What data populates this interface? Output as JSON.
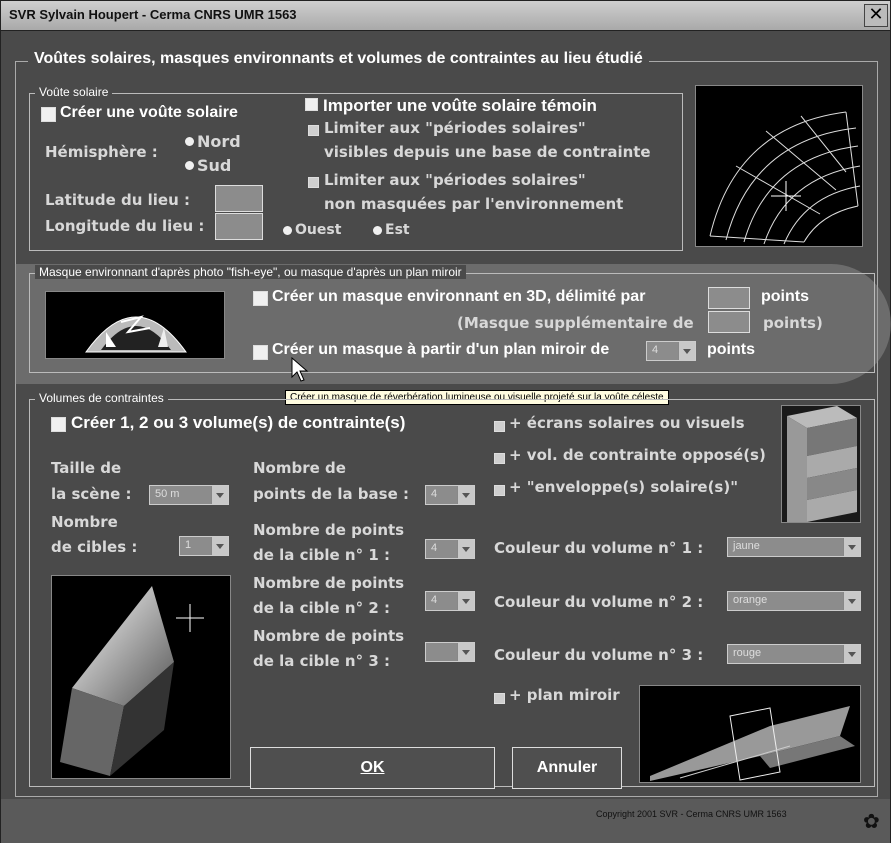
{
  "window": {
    "title": "SVR Sylvain Houpert - Cerma CNRS UMR 1563",
    "close": "✕"
  },
  "main_legend": "Voûtes solaires, masques environnants et volumes de contraintes au lieu étudié",
  "voute": {
    "legend": "Voûte solaire",
    "creer": "Créer une voûte solaire",
    "hemisphere_label": "Hémisphère :",
    "nord": "Nord",
    "sud": "Sud",
    "latitude": "Latitude du lieu :",
    "longitude": "Longitude du lieu :",
    "ouest": "Ouest",
    "est": "Est",
    "importer": "Importer une voûte solaire témoin",
    "limiter1_l1": "Limiter aux \"périodes solaires\"",
    "limiter1_l2": "visibles depuis une base de contrainte",
    "limiter2_l1": "Limiter aux \"périodes solaires\"",
    "limiter2_l2": "non masquées par l'environnement"
  },
  "masque": {
    "legend": "Masque environnant d'après photo \"fish-eye\", ou masque d'après un plan miroir",
    "creer3d": "Créer un masque environnant en 3D, délimité par",
    "points": "points",
    "supplementaire": "(Masque supplémentaire de",
    "points_paren": "points)",
    "plan_miroir": "Créer un masque à partir d'un plan miroir de",
    "plan_miroir_value": "4",
    "points2": "points"
  },
  "tooltip": "Créer un masque de réverbération lumineuse ou visuelle projeté sur la voûte céleste",
  "volumes": {
    "legend": "Volumes de contraintes",
    "creer": "Créer 1, 2 ou 3 volume(s) de contrainte(s)",
    "taille_l1": "Taille de",
    "taille_l2": "la scène :",
    "taille_value": "50 m",
    "cibles_l1": "Nombre",
    "cibles_l2": "de cibles :",
    "cibles_value": "1",
    "base_l1": "Nombre de",
    "base_l2": "points de la base :",
    "base_value": "4",
    "cible1_l1": "Nombre de points",
    "cible1_l2": "de la cible n° 1 :",
    "cible1_value": "4",
    "cible2_l1": "Nombre de points",
    "cible2_l2": "de la cible n° 2 :",
    "cible2_value": "4",
    "cible3_l1": "Nombre de points",
    "cible3_l2": "de la cible n° 3 :",
    "cible3_value": "",
    "ecrans": "+ écrans solaires ou visuels",
    "vol_oppose": "+ vol. de contrainte opposé(s)",
    "enveloppe": "+ \"enveloppe(s) solaire(s)\"",
    "couleur1_label": "Couleur du volume n° 1 :",
    "couleur1_value": "jaune",
    "couleur2_label": "Couleur du volume n° 2 :",
    "couleur2_value": "orange",
    "couleur3_label": "Couleur du volume n° 3 :",
    "couleur3_value": "rouge",
    "plan_miroir": "+ plan miroir"
  },
  "buttons": {
    "ok": "OK",
    "annuler": "Annuler"
  },
  "copyright": "Copyright 2001 SVR - Cerma CNRS UMR 1563"
}
